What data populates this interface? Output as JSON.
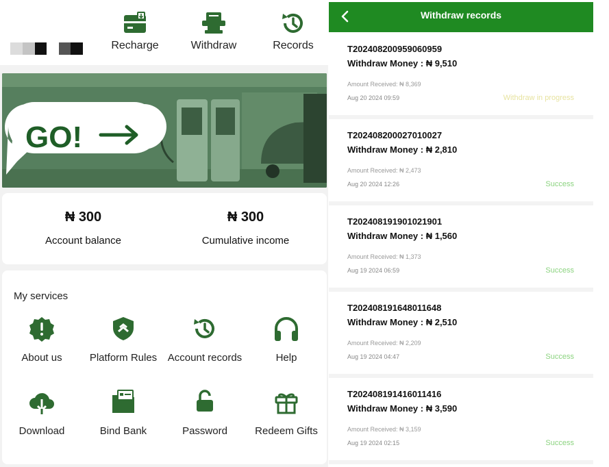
{
  "top_actions": [
    {
      "label": "Recharge",
      "icon": "wallet-card-icon"
    },
    {
      "label": "Withdraw",
      "icon": "atm-withdraw-icon"
    },
    {
      "label": "Records",
      "icon": "history-icon"
    }
  ],
  "banner": {
    "text": "GO!",
    "arrow": "arrow-right-icon"
  },
  "balance": [
    {
      "amount": "₦ 300",
      "caption": "Account balance"
    },
    {
      "amount": "₦ 300",
      "caption": "Cumulative income"
    }
  ],
  "services": {
    "title": "My services",
    "items": [
      {
        "label": "About us",
        "icon": "info-badge-icon"
      },
      {
        "label": "Platform Rules",
        "icon": "shield-icon"
      },
      {
        "label": "Account records",
        "icon": "history-icon"
      },
      {
        "label": "Help",
        "icon": "headphones-icon"
      },
      {
        "label": "Download",
        "icon": "cloud-download-icon"
      },
      {
        "label": "Bind Bank",
        "icon": "bank-card-icon"
      },
      {
        "label": "Password",
        "icon": "unlock-icon"
      },
      {
        "label": "Redeem Gifts",
        "icon": "gift-icon"
      }
    ]
  },
  "records_page": {
    "title": "Withdraw records",
    "records": [
      {
        "id": "T202408200959060959",
        "money": "Withdraw Money : ₦ 9,510",
        "received": "Amount Received: ₦ 8,369",
        "date": "Aug 20 2024 09:59",
        "status": "Withdraw in progress",
        "status_color": "#e7e3a0"
      },
      {
        "id": "T202408200027010027",
        "money": "Withdraw Money : ₦ 2,810",
        "received": "Amount Received: ₦ 2,473",
        "date": "Aug 20 2024 12:26",
        "status": "Success",
        "status_color": "#8bd37f"
      },
      {
        "id": "T202408191901021901",
        "money": "Withdraw Money : ₦ 1,560",
        "received": "Amount Received: ₦ 1,373",
        "date": "Aug 19 2024 06:59",
        "status": "Success",
        "status_color": "#8bd37f"
      },
      {
        "id": "T202408191648011648",
        "money": "Withdraw Money : ₦ 2,510",
        "received": "Amount Received: ₦ 2,209",
        "date": "Aug 19 2024 04:47",
        "status": "Success",
        "status_color": "#8bd37f"
      },
      {
        "id": "T202408191416011416",
        "money": "Withdraw Money : ₦ 3,590",
        "received": "Amount Received: ₦ 3,159",
        "date": "Aug 19 2024 02:15",
        "status": "Success",
        "status_color": "#8bd37f"
      }
    ]
  },
  "colors": {
    "brand_green": "#1f8a22",
    "icon_green": "#2e6b31"
  }
}
